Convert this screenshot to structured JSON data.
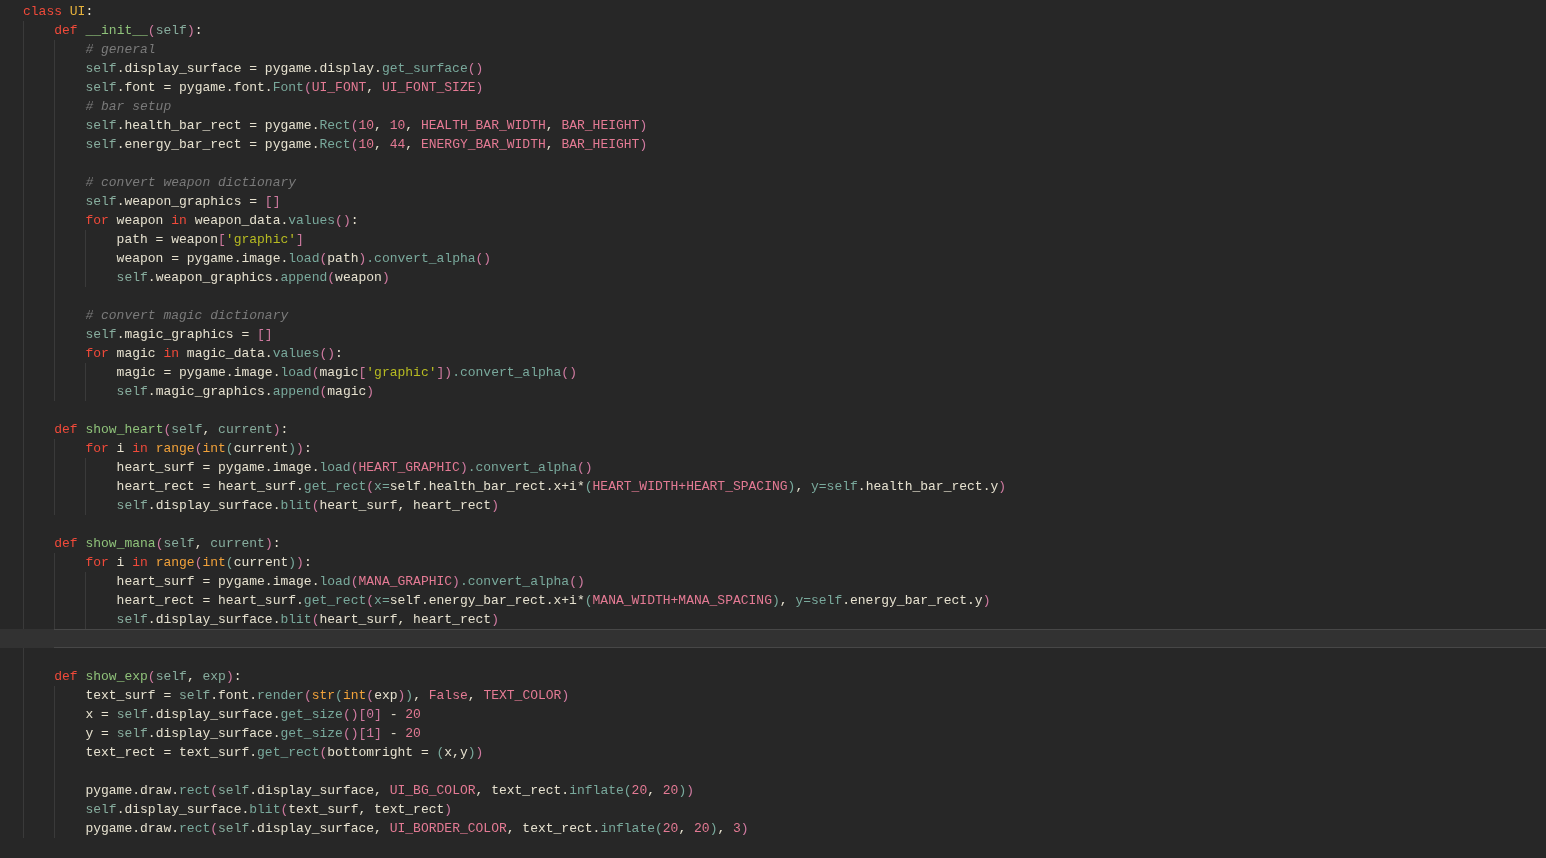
{
  "editor": {
    "lines": [
      {
        "current": false,
        "tokens": [
          {
            "kind": "keyword",
            "text": "class "
          },
          {
            "kind": "class",
            "text": "UI"
          },
          {
            "kind": "plain",
            "text": ":"
          }
        ],
        "children": [
          {
            "current": false,
            "tokens": [
              {
                "kind": "keyword",
                "text": "def "
              },
              {
                "kind": "func",
                "text": "__init__"
              },
              {
                "kind": "bracket",
                "text": "("
              },
              {
                "kind": "self",
                "text": "self"
              },
              {
                "kind": "bracket",
                "text": ")"
              },
              {
                "kind": "plain",
                "text": ":"
              }
            ],
            "children": [
              {
                "current": false,
                "tokens": [
                  {
                    "kind": "comment",
                    "text": "# general"
                  }
                ]
              },
              {
                "current": false,
                "tokens": [
                  {
                    "kind": "self",
                    "text": "self"
                  },
                  {
                    "kind": "plain",
                    "text": ".display_surface = pygame.display."
                  },
                  {
                    "kind": "method",
                    "text": "get_surface"
                  },
                  {
                    "kind": "bracket",
                    "text": "()"
                  }
                ]
              },
              {
                "current": false,
                "tokens": [
                  {
                    "kind": "self",
                    "text": "self"
                  },
                  {
                    "kind": "plain",
                    "text": ".font = pygame.font."
                  },
                  {
                    "kind": "method",
                    "text": "Font"
                  },
                  {
                    "kind": "bracket",
                    "text": "("
                  },
                  {
                    "kind": "const",
                    "text": "UI_FONT"
                  },
                  {
                    "kind": "plain",
                    "text": ", "
                  },
                  {
                    "kind": "const",
                    "text": "UI_FONT_SIZE"
                  },
                  {
                    "kind": "bracket",
                    "text": ")"
                  }
                ]
              },
              {
                "current": false,
                "tokens": [
                  {
                    "kind": "comment",
                    "text": "# bar setup"
                  }
                ]
              },
              {
                "current": false,
                "tokens": [
                  {
                    "kind": "self",
                    "text": "self"
                  },
                  {
                    "kind": "plain",
                    "text": ".health_bar_rect = pygame."
                  },
                  {
                    "kind": "method",
                    "text": "Rect"
                  },
                  {
                    "kind": "bracket",
                    "text": "("
                  },
                  {
                    "kind": "const",
                    "text": "10"
                  },
                  {
                    "kind": "plain",
                    "text": ", "
                  },
                  {
                    "kind": "const",
                    "text": "10"
                  },
                  {
                    "kind": "plain",
                    "text": ", "
                  },
                  {
                    "kind": "const",
                    "text": "HEALTH_BAR_WIDTH"
                  },
                  {
                    "kind": "plain",
                    "text": ", "
                  },
                  {
                    "kind": "const",
                    "text": "BAR_HEIGHT"
                  },
                  {
                    "kind": "bracket",
                    "text": ")"
                  }
                ]
              },
              {
                "current": false,
                "tokens": [
                  {
                    "kind": "self",
                    "text": "self"
                  },
                  {
                    "kind": "plain",
                    "text": ".energy_bar_rect = pygame."
                  },
                  {
                    "kind": "method",
                    "text": "Rect"
                  },
                  {
                    "kind": "bracket",
                    "text": "("
                  },
                  {
                    "kind": "const",
                    "text": "10"
                  },
                  {
                    "kind": "plain",
                    "text": ", "
                  },
                  {
                    "kind": "const",
                    "text": "44"
                  },
                  {
                    "kind": "plain",
                    "text": ", "
                  },
                  {
                    "kind": "const",
                    "text": "ENERGY_BAR_WIDTH"
                  },
                  {
                    "kind": "plain",
                    "text": ", "
                  },
                  {
                    "kind": "const",
                    "text": "BAR_HEIGHT"
                  },
                  {
                    "kind": "bracket",
                    "text": ")"
                  }
                ]
              },
              {
                "current": false
              },
              {
                "current": false,
                "tokens": [
                  {
                    "kind": "comment",
                    "text": "# convert weapon dictionary"
                  }
                ]
              },
              {
                "current": false,
                "tokens": [
                  {
                    "kind": "self",
                    "text": "self"
                  },
                  {
                    "kind": "plain",
                    "text": ".weapon_graphics = "
                  },
                  {
                    "kind": "bracket",
                    "text": "[]"
                  }
                ]
              },
              {
                "current": false,
                "tokens": [
                  {
                    "kind": "keyword",
                    "text": "for"
                  },
                  {
                    "kind": "plain",
                    "text": " weapon "
                  },
                  {
                    "kind": "keyword",
                    "text": "in"
                  },
                  {
                    "kind": "plain",
                    "text": " weapon_data."
                  },
                  {
                    "kind": "method",
                    "text": "values"
                  },
                  {
                    "kind": "bracket",
                    "text": "()"
                  },
                  {
                    "kind": "plain",
                    "text": ":"
                  }
                ],
                "children": [
                  {
                    "current": false,
                    "tokens": [
                      {
                        "kind": "plain",
                        "text": "path = weapon"
                      },
                      {
                        "kind": "bracket",
                        "text": "["
                      },
                      {
                        "kind": "string",
                        "text": "'graphic'"
                      },
                      {
                        "kind": "bracket",
                        "text": "]"
                      }
                    ]
                  },
                  {
                    "current": false,
                    "tokens": [
                      {
                        "kind": "plain",
                        "text": "weapon = pygame.image."
                      },
                      {
                        "kind": "method",
                        "text": "load"
                      },
                      {
                        "kind": "bracket",
                        "text": "("
                      },
                      {
                        "kind": "plain",
                        "text": "path"
                      },
                      {
                        "kind": "bracket",
                        "text": ")"
                      },
                      {
                        "kind": "method",
                        "text": ".convert_alpha"
                      },
                      {
                        "kind": "bracket",
                        "text": "()"
                      }
                    ]
                  },
                  {
                    "current": false,
                    "tokens": [
                      {
                        "kind": "self",
                        "text": "self"
                      },
                      {
                        "kind": "plain",
                        "text": ".weapon_graphics."
                      },
                      {
                        "kind": "method",
                        "text": "append"
                      },
                      {
                        "kind": "bracket",
                        "text": "("
                      },
                      {
                        "kind": "plain",
                        "text": "weapon"
                      },
                      {
                        "kind": "bracket",
                        "text": ")"
                      }
                    ]
                  }
                ]
              },
              {
                "current": false
              },
              {
                "current": false,
                "tokens": [
                  {
                    "kind": "comment",
                    "text": "# convert magic dictionary"
                  }
                ]
              },
              {
                "current": false,
                "tokens": [
                  {
                    "kind": "self",
                    "text": "self"
                  },
                  {
                    "kind": "plain",
                    "text": ".magic_graphics = "
                  },
                  {
                    "kind": "bracket",
                    "text": "[]"
                  }
                ]
              },
              {
                "current": false,
                "tokens": [
                  {
                    "kind": "keyword",
                    "text": "for"
                  },
                  {
                    "kind": "plain",
                    "text": " magic "
                  },
                  {
                    "kind": "keyword",
                    "text": "in"
                  },
                  {
                    "kind": "plain",
                    "text": " magic_data."
                  },
                  {
                    "kind": "method",
                    "text": "values"
                  },
                  {
                    "kind": "bracket",
                    "text": "()"
                  },
                  {
                    "kind": "plain",
                    "text": ":"
                  }
                ],
                "children": [
                  {
                    "current": false,
                    "tokens": [
                      {
                        "kind": "plain",
                        "text": "magic = pygame.image."
                      },
                      {
                        "kind": "method",
                        "text": "load"
                      },
                      {
                        "kind": "bracket",
                        "text": "("
                      },
                      {
                        "kind": "plain",
                        "text": "magic"
                      },
                      {
                        "kind": "bracket",
                        "text": "["
                      },
                      {
                        "kind": "string",
                        "text": "'graphic'"
                      },
                      {
                        "kind": "bracket",
                        "text": "])"
                      },
                      {
                        "kind": "method",
                        "text": ".convert_alpha"
                      },
                      {
                        "kind": "bracket",
                        "text": "()"
                      }
                    ]
                  },
                  {
                    "current": false,
                    "tokens": [
                      {
                        "kind": "self",
                        "text": "self"
                      },
                      {
                        "kind": "plain",
                        "text": ".magic_graphics."
                      },
                      {
                        "kind": "method",
                        "text": "append"
                      },
                      {
                        "kind": "bracket",
                        "text": "("
                      },
                      {
                        "kind": "plain",
                        "text": "magic"
                      },
                      {
                        "kind": "bracket",
                        "text": ")"
                      }
                    ]
                  }
                ]
              }
            ]
          },
          {
            "current": false
          },
          {
            "current": false,
            "tokens": [
              {
                "kind": "keyword",
                "text": "def "
              },
              {
                "kind": "func",
                "text": "show_heart"
              },
              {
                "kind": "bracket",
                "text": "("
              },
              {
                "kind": "self",
                "text": "self"
              },
              {
                "kind": "plain",
                "text": ", "
              },
              {
                "kind": "self",
                "text": "current"
              },
              {
                "kind": "bracket",
                "text": ")"
              },
              {
                "kind": "plain",
                "text": ":"
              }
            ],
            "children": [
              {
                "current": false,
                "tokens": [
                  {
                    "kind": "keyword",
                    "text": "for"
                  },
                  {
                    "kind": "plain",
                    "text": " i "
                  },
                  {
                    "kind": "keyword",
                    "text": "in "
                  },
                  {
                    "kind": "builtin",
                    "text": "range"
                  },
                  {
                    "kind": "bracket",
                    "text": "("
                  },
                  {
                    "kind": "builtin",
                    "text": "int"
                  },
                  {
                    "kind": "bracket2",
                    "text": "("
                  },
                  {
                    "kind": "plain",
                    "text": "current"
                  },
                  {
                    "kind": "bracket2",
                    "text": ")"
                  },
                  {
                    "kind": "bracket",
                    "text": ")"
                  },
                  {
                    "kind": "plain",
                    "text": ":"
                  }
                ],
                "children": [
                  {
                    "current": false,
                    "tokens": [
                      {
                        "kind": "plain",
                        "text": "heart_surf = pygame.image."
                      },
                      {
                        "kind": "method",
                        "text": "load"
                      },
                      {
                        "kind": "bracket",
                        "text": "("
                      },
                      {
                        "kind": "const",
                        "text": "HEART_GRAPHIC"
                      },
                      {
                        "kind": "bracket",
                        "text": ")"
                      },
                      {
                        "kind": "method",
                        "text": ".convert_alpha"
                      },
                      {
                        "kind": "bracket",
                        "text": "()"
                      }
                    ]
                  },
                  {
                    "current": false,
                    "tokens": [
                      {
                        "kind": "plain",
                        "text": "heart_rect = heart_surf."
                      },
                      {
                        "kind": "method",
                        "text": "get_rect"
                      },
                      {
                        "kind": "bracket",
                        "text": "("
                      },
                      {
                        "kind": "method",
                        "text": "x="
                      },
                      {
                        "kind": "plain",
                        "text": "self.health_bar_rect.x+i*"
                      },
                      {
                        "kind": "bracket2",
                        "text": "("
                      },
                      {
                        "kind": "const",
                        "text": "HEART_WIDTH+HEART_SPACING"
                      },
                      {
                        "kind": "bracket2",
                        "text": ")"
                      },
                      {
                        "kind": "plain",
                        "text": ", "
                      },
                      {
                        "kind": "method",
                        "text": "y=self"
                      },
                      {
                        "kind": "plain",
                        "text": ".health_bar_rect.y"
                      },
                      {
                        "kind": "bracket",
                        "text": ")"
                      }
                    ]
                  },
                  {
                    "current": false,
                    "tokens": [
                      {
                        "kind": "self",
                        "text": "self"
                      },
                      {
                        "kind": "plain",
                        "text": ".display_surface."
                      },
                      {
                        "kind": "method",
                        "text": "blit"
                      },
                      {
                        "kind": "bracket",
                        "text": "("
                      },
                      {
                        "kind": "plain",
                        "text": "heart_surf, heart_rect"
                      },
                      {
                        "kind": "bracket",
                        "text": ")"
                      }
                    ]
                  }
                ]
              }
            ]
          },
          {
            "current": false
          },
          {
            "current": false,
            "tokens": [
              {
                "kind": "keyword",
                "text": "def "
              },
              {
                "kind": "func",
                "text": "show_mana"
              },
              {
                "kind": "bracket",
                "text": "("
              },
              {
                "kind": "self",
                "text": "self"
              },
              {
                "kind": "plain",
                "text": ", "
              },
              {
                "kind": "self",
                "text": "current"
              },
              {
                "kind": "bracket",
                "text": ")"
              },
              {
                "kind": "plain",
                "text": ":"
              }
            ],
            "children": [
              {
                "current": false,
                "tokens": [
                  {
                    "kind": "keyword",
                    "text": "for"
                  },
                  {
                    "kind": "plain",
                    "text": " i "
                  },
                  {
                    "kind": "keyword",
                    "text": "in "
                  },
                  {
                    "kind": "builtin",
                    "text": "range"
                  },
                  {
                    "kind": "bracket",
                    "text": "("
                  },
                  {
                    "kind": "builtin",
                    "text": "int"
                  },
                  {
                    "kind": "bracket2",
                    "text": "("
                  },
                  {
                    "kind": "plain",
                    "text": "current"
                  },
                  {
                    "kind": "bracket2",
                    "text": ")"
                  },
                  {
                    "kind": "bracket",
                    "text": ")"
                  },
                  {
                    "kind": "plain",
                    "text": ":"
                  }
                ],
                "children": [
                  {
                    "current": false,
                    "tokens": [
                      {
                        "kind": "plain",
                        "text": "heart_surf = pygame.image."
                      },
                      {
                        "kind": "method",
                        "text": "load"
                      },
                      {
                        "kind": "bracket",
                        "text": "("
                      },
                      {
                        "kind": "const",
                        "text": "MANA_GRAPHIC"
                      },
                      {
                        "kind": "bracket",
                        "text": ")"
                      },
                      {
                        "kind": "method",
                        "text": ".convert_alpha"
                      },
                      {
                        "kind": "bracket",
                        "text": "()"
                      }
                    ]
                  },
                  {
                    "current": false,
                    "tokens": [
                      {
                        "kind": "plain",
                        "text": "heart_rect = heart_surf."
                      },
                      {
                        "kind": "method",
                        "text": "get_rect"
                      },
                      {
                        "kind": "bracket",
                        "text": "("
                      },
                      {
                        "kind": "method",
                        "text": "x="
                      },
                      {
                        "kind": "plain",
                        "text": "self.energy_bar_rect.x+i*"
                      },
                      {
                        "kind": "bracket2",
                        "text": "("
                      },
                      {
                        "kind": "const",
                        "text": "MANA_WIDTH+MANA_SPACING"
                      },
                      {
                        "kind": "bracket2",
                        "text": ")"
                      },
                      {
                        "kind": "plain",
                        "text": ", "
                      },
                      {
                        "kind": "method",
                        "text": "y=self"
                      },
                      {
                        "kind": "plain",
                        "text": ".energy_bar_rect.y"
                      },
                      {
                        "kind": "bracket",
                        "text": ")"
                      }
                    ]
                  },
                  {
                    "current": false,
                    "tokens": [
                      {
                        "kind": "self",
                        "text": "self"
                      },
                      {
                        "kind": "plain",
                        "text": ".display_surface."
                      },
                      {
                        "kind": "method",
                        "text": "blit"
                      },
                      {
                        "kind": "bracket",
                        "text": "("
                      },
                      {
                        "kind": "plain",
                        "text": "heart_surf, heart_rect"
                      },
                      {
                        "kind": "bracket",
                        "text": ")"
                      }
                    ]
                  }
                ]
              }
            ]
          },
          {
            "current": true
          },
          {
            "current": false
          },
          {
            "current": false,
            "tokens": [
              {
                "kind": "keyword",
                "text": "def "
              },
              {
                "kind": "func",
                "text": "show_exp"
              },
              {
                "kind": "bracket",
                "text": "("
              },
              {
                "kind": "self",
                "text": "self"
              },
              {
                "kind": "plain",
                "text": ", "
              },
              {
                "kind": "self",
                "text": "exp"
              },
              {
                "kind": "bracket",
                "text": ")"
              },
              {
                "kind": "plain",
                "text": ":"
              }
            ],
            "children": [
              {
                "current": false,
                "tokens": [
                  {
                    "kind": "plain",
                    "text": "text_surf = "
                  },
                  {
                    "kind": "self",
                    "text": "self"
                  },
                  {
                    "kind": "plain",
                    "text": ".font."
                  },
                  {
                    "kind": "method",
                    "text": "render"
                  },
                  {
                    "kind": "bracket",
                    "text": "("
                  },
                  {
                    "kind": "builtin",
                    "text": "str"
                  },
                  {
                    "kind": "bracket2",
                    "text": "("
                  },
                  {
                    "kind": "builtin",
                    "text": "int"
                  },
                  {
                    "kind": "bracket",
                    "text": "("
                  },
                  {
                    "kind": "plain",
                    "text": "exp"
                  },
                  {
                    "kind": "bracket",
                    "text": ")"
                  },
                  {
                    "kind": "bracket2",
                    "text": ")"
                  },
                  {
                    "kind": "plain",
                    "text": ", "
                  },
                  {
                    "kind": "const",
                    "text": "False"
                  },
                  {
                    "kind": "plain",
                    "text": ", "
                  },
                  {
                    "kind": "const",
                    "text": "TEXT_COLOR"
                  },
                  {
                    "kind": "bracket",
                    "text": ")"
                  }
                ]
              },
              {
                "current": false,
                "tokens": [
                  {
                    "kind": "plain",
                    "text": "x = "
                  },
                  {
                    "kind": "self",
                    "text": "self"
                  },
                  {
                    "kind": "plain",
                    "text": ".display_surface."
                  },
                  {
                    "kind": "method",
                    "text": "get_size"
                  },
                  {
                    "kind": "bracket",
                    "text": "()[0]"
                  },
                  {
                    "kind": "plain",
                    "text": " - "
                  },
                  {
                    "kind": "const",
                    "text": "20"
                  }
                ]
              },
              {
                "current": false,
                "tokens": [
                  {
                    "kind": "plain",
                    "text": "y = "
                  },
                  {
                    "kind": "self",
                    "text": "self"
                  },
                  {
                    "kind": "plain",
                    "text": ".display_surface."
                  },
                  {
                    "kind": "method",
                    "text": "get_size"
                  },
                  {
                    "kind": "bracket",
                    "text": "()[1]"
                  },
                  {
                    "kind": "plain",
                    "text": " - "
                  },
                  {
                    "kind": "const",
                    "text": "20"
                  }
                ]
              },
              {
                "current": false,
                "tokens": [
                  {
                    "kind": "plain",
                    "text": "text_rect = text_surf."
                  },
                  {
                    "kind": "method",
                    "text": "get_rect"
                  },
                  {
                    "kind": "bracket",
                    "text": "("
                  },
                  {
                    "kind": "plain",
                    "text": "bottomright = "
                  },
                  {
                    "kind": "bracket2",
                    "text": "("
                  },
                  {
                    "kind": "plain",
                    "text": "x,y"
                  },
                  {
                    "kind": "bracket2",
                    "text": ")"
                  },
                  {
                    "kind": "bracket",
                    "text": ")"
                  }
                ]
              },
              {
                "current": false
              },
              {
                "current": false,
                "tokens": [
                  {
                    "kind": "plain",
                    "text": "pygame.draw."
                  },
                  {
                    "kind": "method",
                    "text": "rect"
                  },
                  {
                    "kind": "bracket",
                    "text": "("
                  },
                  {
                    "kind": "self",
                    "text": "self"
                  },
                  {
                    "kind": "plain",
                    "text": ".display_surface, "
                  },
                  {
                    "kind": "const",
                    "text": "UI_BG_COLOR"
                  },
                  {
                    "kind": "plain",
                    "text": ", text_rect."
                  },
                  {
                    "kind": "method",
                    "text": "inflate"
                  },
                  {
                    "kind": "bracket2",
                    "text": "("
                  },
                  {
                    "kind": "const",
                    "text": "20"
                  },
                  {
                    "kind": "plain",
                    "text": ", "
                  },
                  {
                    "kind": "const",
                    "text": "20"
                  },
                  {
                    "kind": "bracket2",
                    "text": ")"
                  },
                  {
                    "kind": "bracket",
                    "text": ")"
                  }
                ]
              },
              {
                "current": false,
                "tokens": [
                  {
                    "kind": "self",
                    "text": "self"
                  },
                  {
                    "kind": "plain",
                    "text": ".display_surface."
                  },
                  {
                    "kind": "method",
                    "text": "blit"
                  },
                  {
                    "kind": "bracket",
                    "text": "("
                  },
                  {
                    "kind": "plain",
                    "text": "text_surf, text_rect"
                  },
                  {
                    "kind": "bracket",
                    "text": ")"
                  }
                ]
              },
              {
                "current": false,
                "tokens": [
                  {
                    "kind": "plain",
                    "text": "pygame.draw."
                  },
                  {
                    "kind": "method",
                    "text": "rect"
                  },
                  {
                    "kind": "bracket",
                    "text": "("
                  },
                  {
                    "kind": "self",
                    "text": "self"
                  },
                  {
                    "kind": "plain",
                    "text": ".display_surface, "
                  },
                  {
                    "kind": "const",
                    "text": "UI_BORDER_COLOR"
                  },
                  {
                    "kind": "plain",
                    "text": ", text_rect."
                  },
                  {
                    "kind": "method",
                    "text": "inflate"
                  },
                  {
                    "kind": "bracket2",
                    "text": "("
                  },
                  {
                    "kind": "const",
                    "text": "20"
                  },
                  {
                    "kind": "plain",
                    "text": ", "
                  },
                  {
                    "kind": "const",
                    "text": "20"
                  },
                  {
                    "kind": "bracket2",
                    "text": ")"
                  },
                  {
                    "kind": "plain",
                    "text": ", "
                  },
                  {
                    "kind": "const",
                    "text": "3"
                  },
                  {
                    "kind": "bracket",
                    "text": ")"
                  }
                ]
              }
            ]
          }
        ]
      }
    ]
  }
}
